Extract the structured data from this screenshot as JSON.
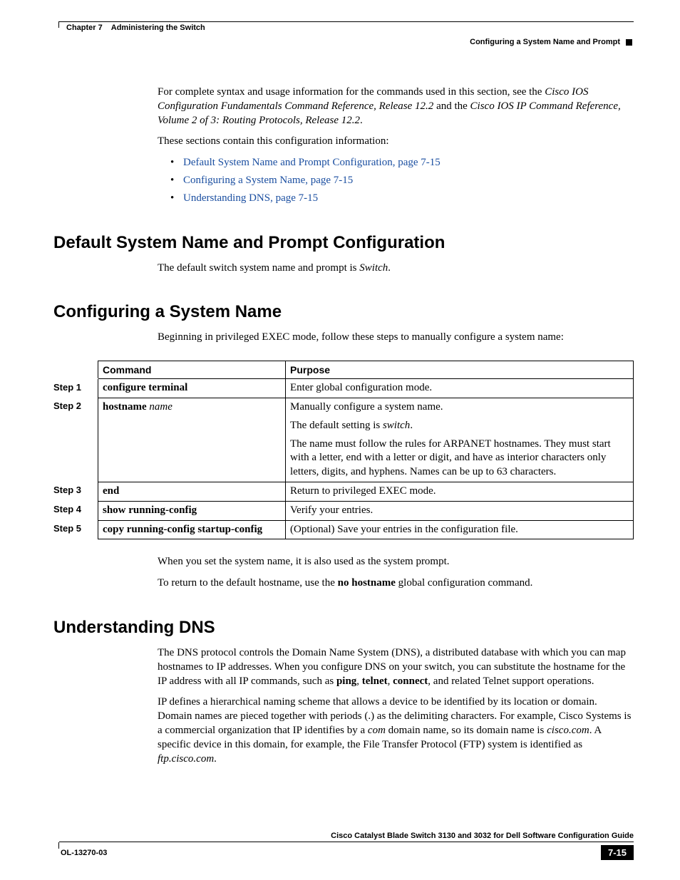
{
  "header": {
    "chapter_label": "Chapter 7",
    "chapter_title": "Administering the Switch",
    "section_title": "Configuring a System Name and Prompt"
  },
  "intro": {
    "p1_a": "For complete syntax and usage information for the commands used in this section, see the ",
    "p1_i1": "Cisco IOS Configuration Fundamentals Command Reference, Release 12.2",
    "p1_b": " and the ",
    "p1_i2": "Cisco IOS IP Command Reference, Volume 2 of 3: Routing Protocols, Release 12.2",
    "p1_c": ".",
    "p2": "These sections contain this configuration information:",
    "links": [
      "Default System Name and Prompt Configuration, page 7-15",
      "Configuring a System Name, page 7-15",
      "Understanding DNS, page 7-15"
    ]
  },
  "sec1": {
    "heading": "Default System Name and Prompt Configuration",
    "p1_a": "The default switch system name and prompt is ",
    "p1_i": "Switch",
    "p1_b": "."
  },
  "sec2": {
    "heading": "Configuring a System Name",
    "intro": "Beginning in privileged EXEC mode, follow these steps to manually configure a system name:",
    "th_command": "Command",
    "th_purpose": "Purpose",
    "steps": {
      "s1": {
        "label": "Step 1",
        "cmd": "configure terminal",
        "purpose": "Enter global configuration mode."
      },
      "s2": {
        "label": "Step 2",
        "cmd_b": "hostname",
        "cmd_i": "name",
        "p1": "Manually configure a system name.",
        "p2_a": "The default setting is ",
        "p2_i": "switch",
        "p2_b": ".",
        "p3": "The name must follow the rules for ARPANET hostnames. They must start with a letter, end with a letter or digit, and have as interior characters only letters, digits, and hyphens. Names can be up to 63 characters."
      },
      "s3": {
        "label": "Step 3",
        "cmd": "end",
        "purpose": "Return to privileged EXEC mode."
      },
      "s4": {
        "label": "Step 4",
        "cmd": "show running-config",
        "purpose": "Verify your entries."
      },
      "s5": {
        "label": "Step 5",
        "cmd": "copy running-config startup-config",
        "purpose": "(Optional) Save your entries in the configuration file."
      }
    },
    "after1": "When you set the system name, it is also used as the system prompt.",
    "after2_a": "To return to the default hostname, use the ",
    "after2_b": "no hostname",
    "after2_c": " global configuration command."
  },
  "sec3": {
    "heading": "Understanding DNS",
    "p1_a": "The DNS protocol controls the Domain Name System (DNS), a distributed database with which you can map hostnames to IP addresses. When you configure DNS on your switch, you can substitute the hostname for the IP address with all IP commands, such as ",
    "p1_b1": "ping",
    "p1_s1": ", ",
    "p1_b2": "telnet",
    "p1_s2": ", ",
    "p1_b3": "connect",
    "p1_c": ", and related Telnet support operations.",
    "p2_a": "IP defines a hierarchical naming scheme that allows a device to be identified by its location or domain. Domain names are pieced together with periods (.) as the delimiting characters. For example, Cisco Systems is a commercial organization that IP identifies by a ",
    "p2_i1": "com",
    "p2_b": " domain name, so its domain name is ",
    "p2_i2": "cisco.com",
    "p2_c": ". A specific device in this domain, for example, the File Transfer Protocol (FTP) system is identified as ",
    "p2_i3": "ftp.cisco.com",
    "p2_d": "."
  },
  "footer": {
    "guide": "Cisco Catalyst Blade Switch 3130 and 3032 for Dell Software Configuration Guide",
    "docid": "OL-13270-03",
    "page": "7-15"
  }
}
